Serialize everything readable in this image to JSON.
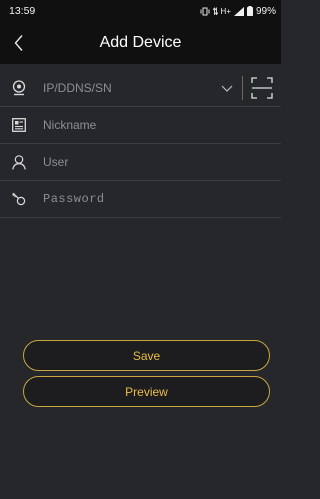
{
  "status_bar": {
    "time": "13:59",
    "network": "H+",
    "battery": "99%"
  },
  "header": {
    "title": "Add Device"
  },
  "form": {
    "address": {
      "placeholder": "IP/DDNS/SN",
      "value": ""
    },
    "nickname": {
      "placeholder": "Nickname",
      "value": ""
    },
    "user": {
      "placeholder": "User",
      "value": ""
    },
    "password": {
      "placeholder": "Password",
      "value": ""
    }
  },
  "buttons": {
    "save": "Save",
    "preview": "Preview"
  },
  "colors": {
    "accent": "#e9bd45",
    "background": "#26272b",
    "bar": "#101010",
    "divider": "#3c3d42"
  }
}
